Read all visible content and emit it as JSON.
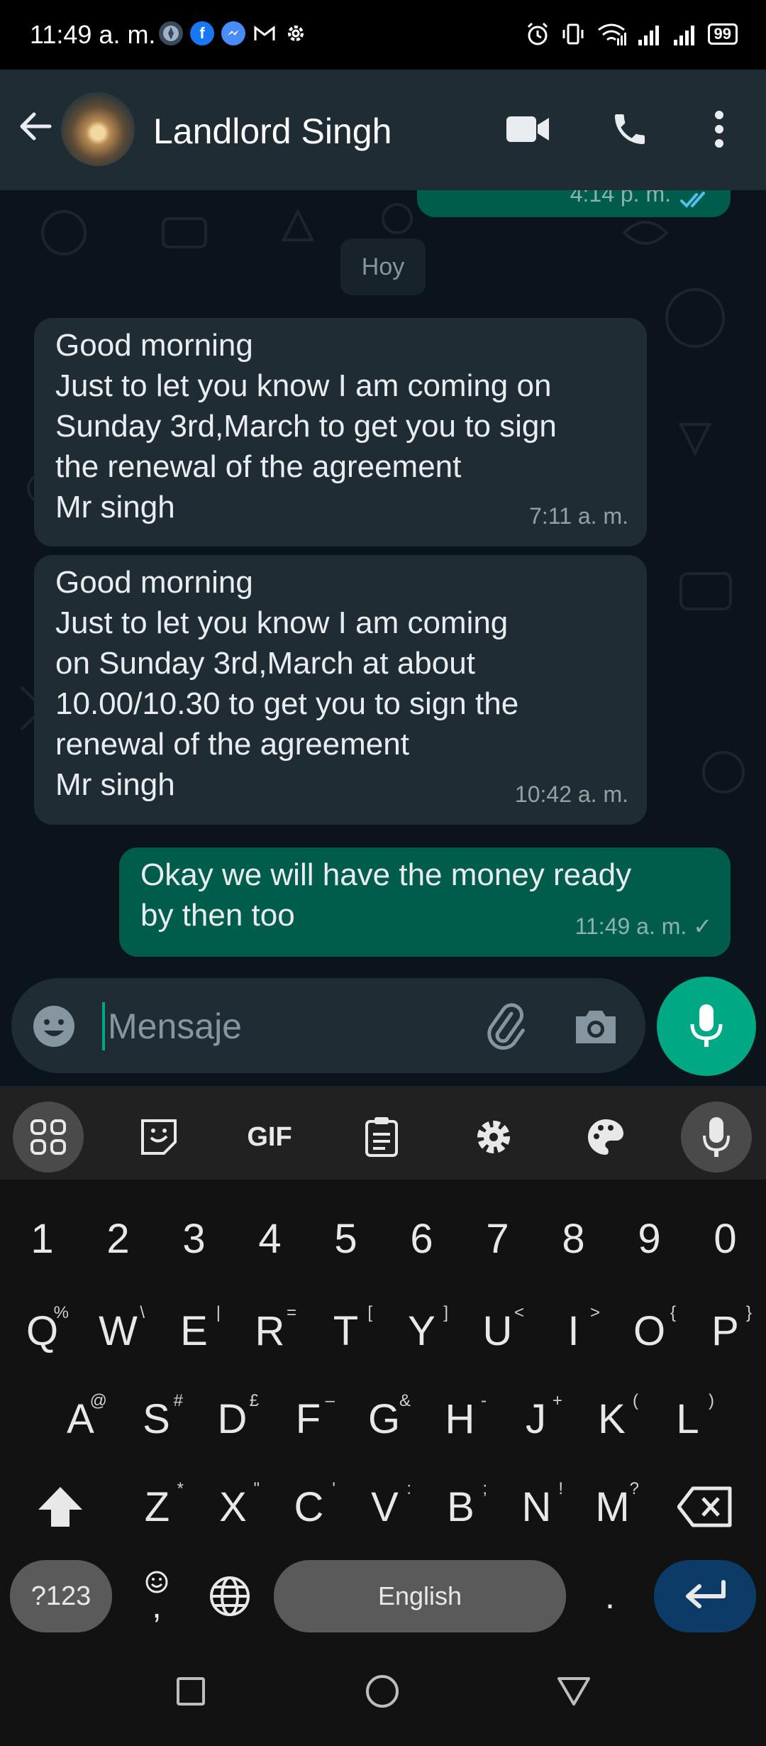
{
  "status_bar": {
    "time": "11:49 a. m.",
    "battery": "99",
    "left_icons": [
      "browser-icon",
      "facebook-icon",
      "messenger-icon",
      "gmail-icon",
      "settings-icon"
    ],
    "right_icons": [
      "alarm-icon",
      "vibrate-icon",
      "wifi-icon",
      "signal-icon",
      "signal-icon",
      "battery-icon"
    ]
  },
  "header": {
    "contact_name": "Landlord Singh",
    "actions": [
      "video-call-icon",
      "voice-call-icon",
      "more-icon"
    ]
  },
  "chat": {
    "prev_message_time": "4:14 p. m.",
    "date_chip": "Hoy",
    "messages": [
      {
        "direction": "incoming",
        "text": "Good morning\nJust to let you know I am coming on\nSunday 3rd,March to get you to sign\nthe renewal of the agreement\nMr singh",
        "time": "7:11 a. m."
      },
      {
        "direction": "incoming",
        "text": "Good morning\nJust to let you know I am coming\non Sunday 3rd,March at about\n10.00/10.30 to get you to sign the\nrenewal of the agreement\nMr singh",
        "time": "10:42 a. m."
      },
      {
        "direction": "outgoing",
        "text": "Okay we will have the money ready\nby then too",
        "time": "11:49 a. m. ✓"
      }
    ]
  },
  "composer": {
    "placeholder": "Mensaje"
  },
  "keyboard": {
    "toolbar": [
      "apps-icon",
      "sticker-icon",
      "GIF",
      "clipboard-icon",
      "settings-icon",
      "theme-icon",
      "mic-icon"
    ],
    "gif_label": "GIF",
    "row_numbers": [
      "1",
      "2",
      "3",
      "4",
      "5",
      "6",
      "7",
      "8",
      "9",
      "0"
    ],
    "row1": [
      [
        "Q",
        "%"
      ],
      [
        "W",
        "\\"
      ],
      [
        "E",
        "|"
      ],
      [
        "R",
        "="
      ],
      [
        "T",
        "["
      ],
      [
        "Y",
        "]"
      ],
      [
        "U",
        "<"
      ],
      [
        "I",
        ">"
      ],
      [
        "O",
        "{"
      ],
      [
        "P",
        "}"
      ]
    ],
    "row2": [
      [
        "A",
        "@"
      ],
      [
        "S",
        "#"
      ],
      [
        "D",
        "£"
      ],
      [
        "F",
        "–"
      ],
      [
        "G",
        "&"
      ],
      [
        "H",
        "-"
      ],
      [
        "J",
        "+"
      ],
      [
        "K",
        "("
      ],
      [
        "L",
        ")"
      ]
    ],
    "row3": [
      [
        "Z",
        "*"
      ],
      [
        "X",
        "\""
      ],
      [
        "C",
        "'"
      ],
      [
        "V",
        ":"
      ],
      [
        "B",
        ";"
      ],
      [
        "N",
        "!"
      ],
      [
        "M",
        "?"
      ]
    ],
    "symbols_label": "?123",
    "comma_label": ",",
    "space_label": "English",
    "period_label": "."
  }
}
